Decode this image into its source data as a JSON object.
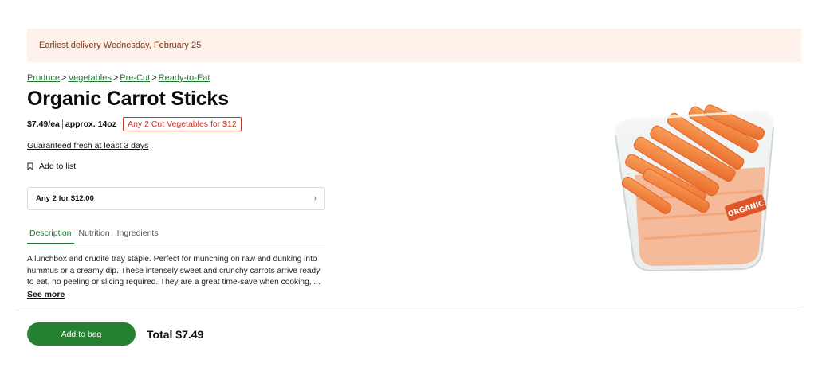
{
  "banner": {
    "text": "Earliest delivery Wednesday, February 25"
  },
  "breadcrumb": [
    "Produce",
    "Vegetables",
    "Pre-Cut",
    "Ready-to-Eat"
  ],
  "product": {
    "title": "Organic Carrot Sticks",
    "price": "$7.49/ea",
    "size": "approx. 14oz",
    "promo": "Any 2 Cut Vegetables for $12",
    "fresh_guarantee": "Guaranteed fresh at least 3 days",
    "add_to_list": "Add to list",
    "image_label": "ORGANIC"
  },
  "deal": {
    "label": "Any 2 for $12.00",
    "chevron": "›"
  },
  "tabs": [
    "Description",
    "Nutrition",
    "Ingredients"
  ],
  "description": {
    "text": "A lunchbox and crudité tray staple. Perfect for munching on raw and dunking into hummus or a creamy dip. These intensely sweet and crunchy carrots arrive ready to eat, no peeling or slicing required. They are a great time-save when cooking, ...",
    "see_more": "See more"
  },
  "footer": {
    "add_to_bag": "Add to bag",
    "total": "Total $7.49"
  },
  "colors": {
    "accent": "#24812f",
    "promo": "#c8352b",
    "banner_bg": "#fdf1ea",
    "carrot": "#f07a3a"
  }
}
